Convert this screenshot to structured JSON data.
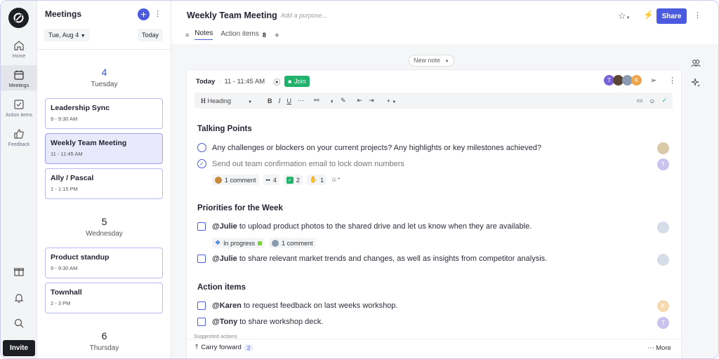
{
  "rail": {
    "items": [
      {
        "label": "Home"
      },
      {
        "label": "Meetings"
      },
      {
        "label": "Action items"
      },
      {
        "label": "Feedback"
      }
    ],
    "invite_label": "Invite"
  },
  "meetings": {
    "title": "Meetings",
    "date_selector": "Tue, Aug 4",
    "today_label": "Today",
    "days": [
      {
        "num": "4",
        "name": "Tuesday",
        "items": [
          {
            "title": "Leadership Sync",
            "time": "9 - 9:30 AM"
          },
          {
            "title": "Weekly Team Meeting",
            "time": "11 - 11:45 AM"
          },
          {
            "title": "Ally / Pascal",
            "time": "1 - 1:15 PM"
          }
        ]
      },
      {
        "num": "5",
        "name": "Wednesday",
        "items": [
          {
            "title": "Product standup",
            "time": "9 - 9:30 AM"
          },
          {
            "title": "Townhall",
            "time": "2 - 3 PM"
          }
        ]
      },
      {
        "num": "6",
        "name": "Thursday",
        "items": []
      }
    ]
  },
  "header": {
    "title": "Weekly Team Meeting",
    "purpose_placeholder": "Add a purpose...",
    "share_label": "Share"
  },
  "tabs": {
    "notes_label": "Notes",
    "action_items_label": "Action items",
    "action_items_count": "8",
    "add_label": "+"
  },
  "new_note_label": "New note",
  "note": {
    "date_label": "Today",
    "time": "11 - 11:45 AM",
    "join_label": "Join",
    "attendees": [
      "T",
      "K"
    ],
    "toolbar": {
      "style_label": "Heading"
    },
    "sections": [
      {
        "title": "Talking Points"
      },
      {
        "title": "Priorities for the Week"
      },
      {
        "title": "Action items"
      }
    ],
    "talking_points": [
      {
        "text": "Any challenges or blockers on your current projects? Any highlights or key milestones achieved?"
      },
      {
        "text": "Send out team confirmation email to lock down numbers"
      }
    ],
    "reactions": {
      "comment": "1 comment",
      "eyes": "4",
      "check": "2",
      "thumbs": "1"
    },
    "priorities": [
      {
        "mention": "@Julie",
        "text": " to upload product photos to the shared drive and let us know when they are available."
      },
      {
        "mention": "@Julie",
        "text": " to share relevant market trends and changes, as well as insights from competitor analysis."
      }
    ],
    "priority_status": {
      "status": "In progress",
      "comment": "1 comment"
    },
    "action_items": [
      {
        "mention": "@Karen",
        "text": " to request feedback on last weeks workshop.",
        "avatar": "K"
      },
      {
        "mention": "@Tony",
        "text": " to share workshop deck.",
        "avatar": "T"
      }
    ],
    "suggested_label": "Suggested actions",
    "carry_label": "Carry forward",
    "carry_count": "2",
    "more_label": "More"
  },
  "colors": {
    "accent": "#4a5be0",
    "join": "#22b26b"
  }
}
